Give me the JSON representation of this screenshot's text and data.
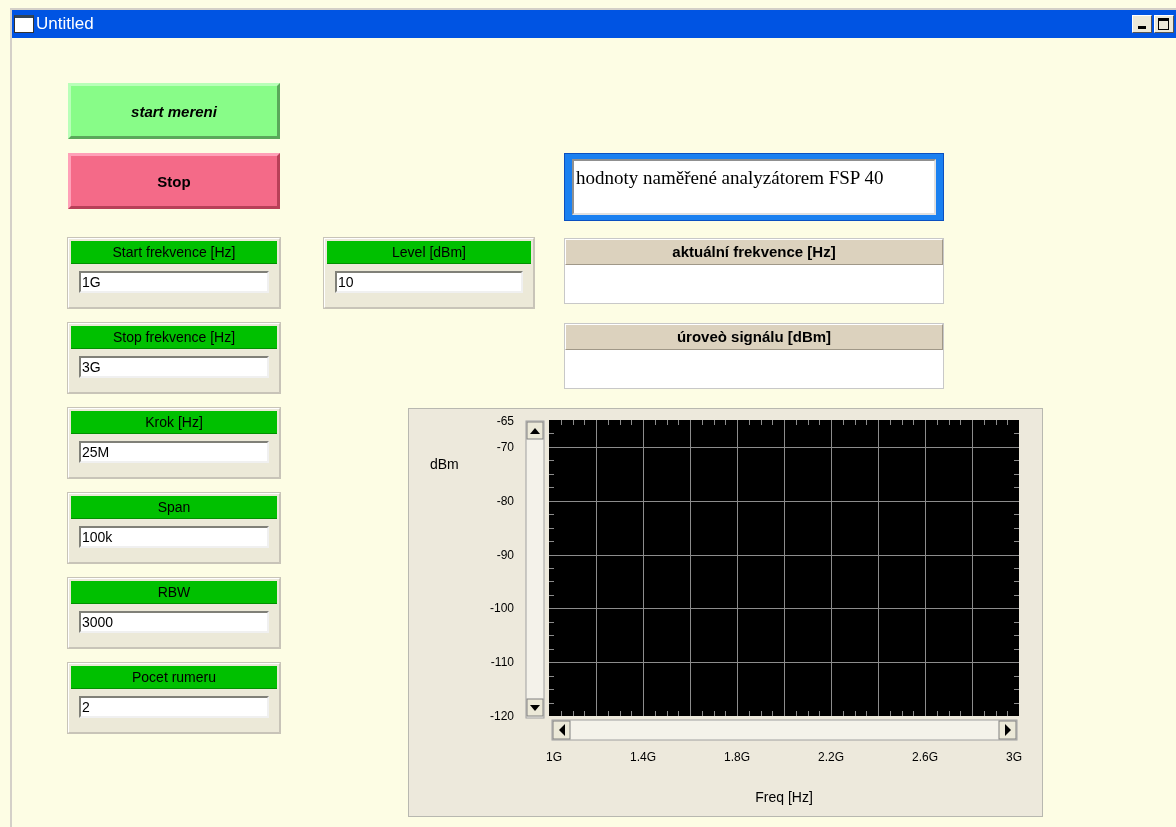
{
  "window": {
    "title": "Untitled"
  },
  "buttons": [
    {
      "label": "start mereni",
      "kind": "start"
    },
    {
      "label": "Stop",
      "kind": "stop"
    }
  ],
  "inputs": [
    {
      "label": "Start frekvence [Hz]",
      "value": "1G"
    },
    {
      "label": "Stop frekvence [Hz]",
      "value": "3G"
    },
    {
      "label": "Krok [Hz]",
      "value": "25M"
    },
    {
      "label": "Span",
      "value": "100k"
    },
    {
      "label": "RBW",
      "value": "3000"
    },
    {
      "label": "Pocet rumeru",
      "value": "2"
    }
  ],
  "level_input": {
    "label": "Level [dBm]",
    "value": "10"
  },
  "note_field": {
    "value": "hodnoty naměřené analyzátorem FSP 40"
  },
  "readouts": [
    {
      "label": "aktuální frekvence [Hz]"
    },
    {
      "label": "úroveò signálu [dBm]"
    }
  ],
  "graph": {
    "chart_data": {
      "type": "line",
      "grid": true,
      "xlabel": "Freq [Hz]",
      "ylabel": "dBm",
      "xlim": [
        1,
        3
      ],
      "ylim": [
        -120,
        -65
      ],
      "xticks": [
        {
          "value": 1,
          "label": "1G"
        },
        {
          "value": 1.4,
          "label": "1.4G"
        },
        {
          "value": 1.8,
          "label": "1.8G"
        },
        {
          "value": 2.2,
          "label": "2.2G"
        },
        {
          "value": 2.6,
          "label": "2.6G"
        },
        {
          "value": 3,
          "label": "3G"
        }
      ],
      "yticks": [
        -65,
        -70,
        -80,
        -90,
        -100,
        -110,
        -120
      ]
    }
  }
}
